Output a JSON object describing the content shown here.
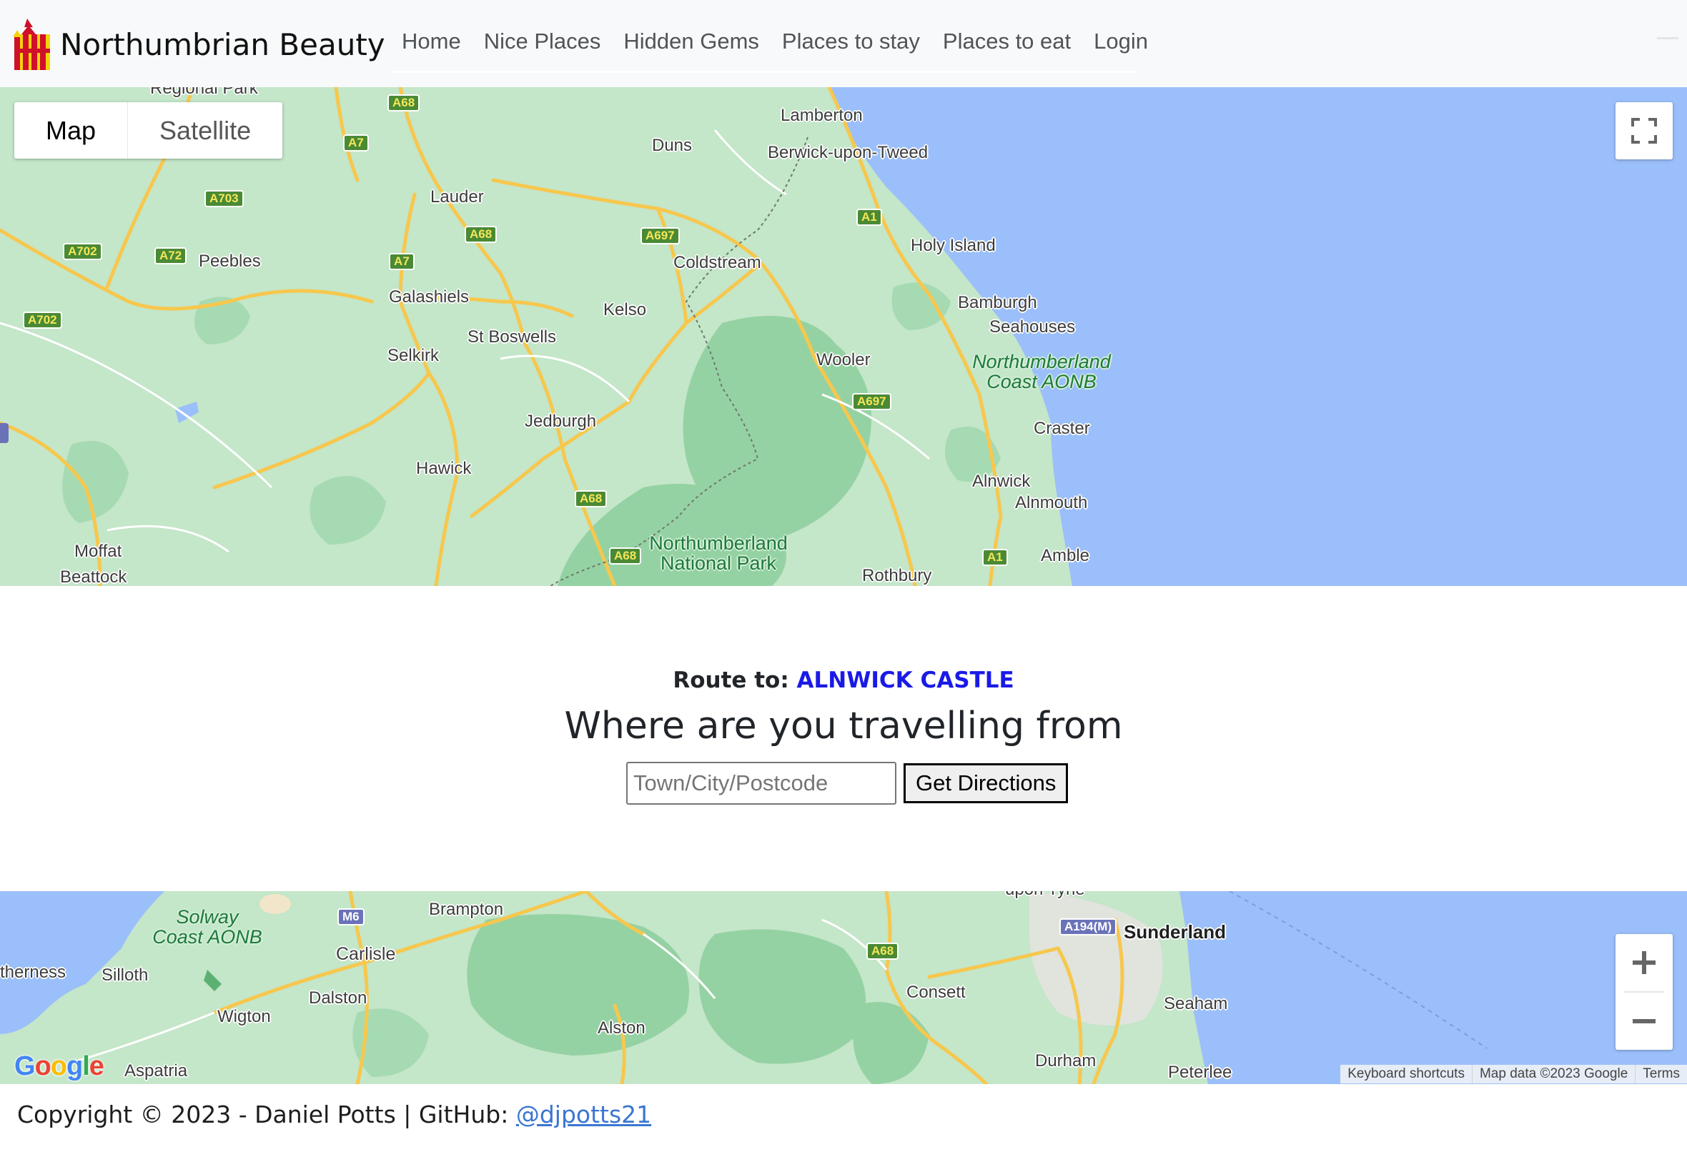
{
  "brand": {
    "name": "Northumbrian Beauty",
    "logo_icon": "northumberland-flag-icon",
    "flag_colors": [
      "#d0102a",
      "#f6d20a"
    ]
  },
  "nav": {
    "items": [
      {
        "label": "Home"
      },
      {
        "label": "Nice Places"
      },
      {
        "label": "Hidden Gems"
      },
      {
        "label": "Places to stay"
      },
      {
        "label": "Places to eat"
      },
      {
        "label": "Login"
      }
    ]
  },
  "top_map": {
    "map_type": {
      "map": "Map",
      "satellite": "Satellite",
      "selected": "Map"
    },
    "fullscreen_icon": "fullscreen-icon",
    "places": {
      "regional_park": "Regional Park",
      "lamberton": "Lamberton",
      "duns": "Duns",
      "berwick": "Berwick-upon-Tweed",
      "lauder": "Lauder",
      "holy_island": "Holy Island",
      "peebles": "Peebles",
      "coldstream": "Coldstream",
      "galashiels": "Galashiels",
      "bamburgh": "Bamburgh",
      "kelso": "Kelso",
      "seahouses": "Seahouses",
      "st_boswells": "St Boswells",
      "selkirk": "Selkirk",
      "wooler": "Wooler",
      "coast_aonb_1": "Northumberland",
      "coast_aonb_2": "Coast AONB",
      "jedburgh": "Jedburgh",
      "craster": "Craster",
      "hawick": "Hawick",
      "alnwick": "Alnwick",
      "alnmouth": "Alnmouth",
      "national_park_1": "Northumberland",
      "national_park_2": "National Park",
      "moffat": "Moffat",
      "amble": "Amble",
      "beattock": "Beattock",
      "rothbury": "Rothbury"
    },
    "roads": {
      "a68_top": "A68",
      "a7_1": "A7",
      "a703": "A703",
      "a1_top": "A1",
      "a702_1": "A702",
      "a72": "A72",
      "a68_2": "A68",
      "a697_1": "A697",
      "a7_2": "A7",
      "a702_2": "A702",
      "a697_2": "A697",
      "a68_3": "A68",
      "a68_4": "A68",
      "a1_bottom": "A1"
    }
  },
  "route": {
    "prefix": "Route to:",
    "destination": "ALNWICK CASTLE",
    "heading": "Where are you travelling from",
    "input_placeholder": "Town/City/Postcode",
    "button_label": "Get Directions"
  },
  "bottom_map": {
    "places": {
      "upon_tyne": "upon Tyne",
      "solway_1": "Solway",
      "solway_2": "Coast AONB",
      "brampton": "Brampton",
      "sunderland": "Sunderland",
      "carlisle": "Carlisle",
      "therness": "therness",
      "silloth": "Silloth",
      "consett": "Consett",
      "seaham": "Seaham",
      "dalston": "Dalston",
      "wigton": "Wigton",
      "alston": "Alston",
      "durham": "Durham",
      "aspatria": "Aspatria",
      "peterlee": "Peterlee"
    },
    "roads": {
      "m6": "M6",
      "a194m": "A194(M)",
      "a68": "A68"
    },
    "zoom_in_icon": "plus-icon",
    "zoom_out_icon": "minus-icon",
    "google_logo": "Google",
    "attribution": {
      "shortcuts": "Keyboard shortcuts",
      "map_data": "Map data ©2023 Google",
      "terms": "Terms"
    }
  },
  "footer": {
    "text": "Copyright © 2023 - Daniel Potts | GitHub:",
    "link": "@djpotts21"
  },
  "colors": {
    "sea": "#9bbffa",
    "land": "#bfe2c4",
    "woodland": "#96d3a4",
    "roads": "#f7c74d",
    "route_destination": "#1a1ae6",
    "footer_link": "#3b76d1"
  }
}
